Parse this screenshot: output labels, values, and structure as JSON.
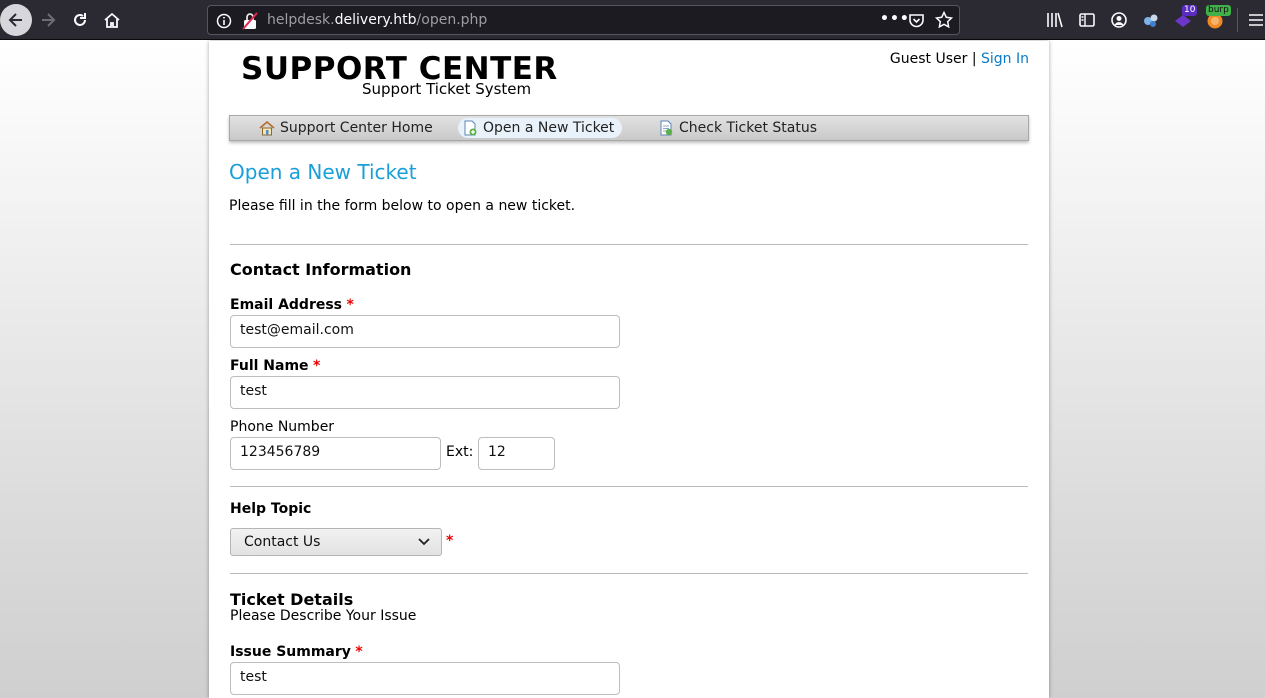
{
  "browser": {
    "url_prefix": "helpdesk.",
    "url_host": "delivery.htb",
    "url_path": "/open.php",
    "ext_badge_count": "10",
    "burp_badge": "burp"
  },
  "header": {
    "logo_title": "SUPPORT CENTER",
    "logo_subtitle": "Support Ticket System",
    "user_label": "Guest User",
    "separator": "|",
    "sign_in": "Sign In"
  },
  "nav": {
    "items": [
      {
        "label": "Support Center Home"
      },
      {
        "label": "Open a New Ticket"
      },
      {
        "label": "Check Ticket Status"
      }
    ]
  },
  "page": {
    "title": "Open a New Ticket",
    "intro": "Please fill in the form below to open a new ticket."
  },
  "contact": {
    "heading": "Contact Information",
    "email_label": "Email Address",
    "email_value": "test@email.com",
    "name_label": "Full Name",
    "name_value": "test",
    "phone_label": "Phone Number",
    "phone_value": "123456789",
    "ext_label": "Ext:",
    "ext_value": "12"
  },
  "help_topic": {
    "heading": "Help Topic",
    "selected": "Contact Us"
  },
  "ticket": {
    "heading": "Ticket Details",
    "subheading": "Please Describe Your Issue",
    "summary_label": "Issue Summary",
    "summary_value": "test"
  },
  "required_mark": "*"
}
